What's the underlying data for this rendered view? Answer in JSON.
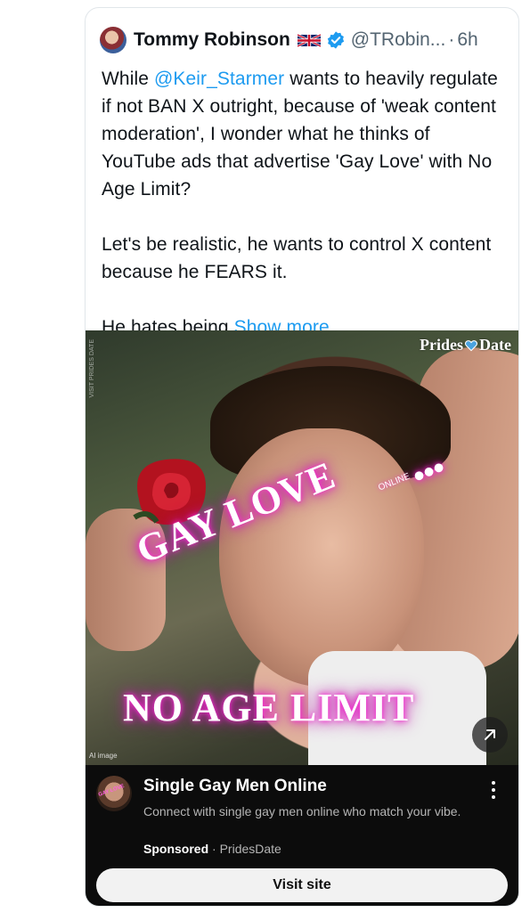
{
  "tweet": {
    "author_name": "Tommy Robinson",
    "handle": "@TRobin...",
    "separator": "·",
    "time": "6h",
    "text": {
      "p1_before": "While ",
      "p1_mention": "@Keir_Starmer",
      "p1_after": " wants to heavily regulate if not BAN X outright, because of 'weak content moderation', I wonder what he thinks of YouTube ads that advertise 'Gay Love' with No Age Limit?",
      "p2": "Let's be realistic, he wants to control X content because he FEARS it.",
      "p3_before": "He hates being ",
      "show_more": "Show more"
    },
    "icons": {
      "flag": "uk-flag-icon",
      "verified": "verified-badge-icon"
    }
  },
  "media": {
    "brand_left": "Prides",
    "brand_right": "Date",
    "headline": "GAY LOVE",
    "online_tag": "ONLINE",
    "dots": "•••",
    "subheadline": "NO AGE LIMIT",
    "ai_label": "AI image",
    "side_caption": "VISIT PRIDES DATE",
    "accent_glow": "#ff2bd6"
  },
  "ad": {
    "title": "Single Gay Men Online",
    "description": "Connect with single gay men online who match your vibe.",
    "sponsored": "Sponsored",
    "meta_separator": " · ",
    "advertiser": "PridesDate",
    "cta": "Visit site",
    "avatar_text": "GAY LOVE"
  },
  "colors": {
    "link": "#1d9bf0",
    "text": "#0f1419",
    "muted": "#536471",
    "ad_bg": "#0c0c0c"
  }
}
